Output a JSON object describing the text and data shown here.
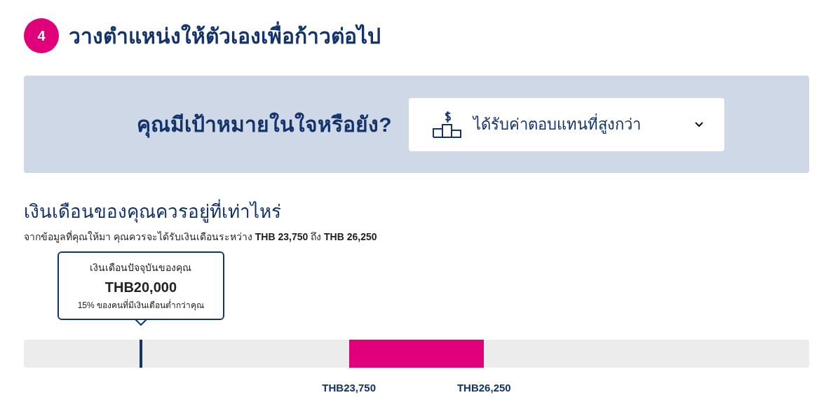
{
  "step": {
    "number": "4",
    "title": "วางตำแหน่งให้ตัวเองเพื่อก้าวต่อไป"
  },
  "goal": {
    "question": "คุณมีเป้าหมายในใจหรือยัง?",
    "value": "ได้รับค่าตอบแทนที่สูงกว่า"
  },
  "salary": {
    "title": "เงินเดือนของคุณควรอยู่ที่เท่าไหร่",
    "subtitle": "จากข้อมูลที่คุณให้มา คุณควรจะได้รับเงินเดือนระหว่าง **THB 23,750** ถึง **THB 26,250**",
    "current": {
      "label": "เงินเดือนปัจจุบันของคุณ",
      "amount": "THB20,000",
      "note": "15% ของคนที่มีเงินเดือนต่ำกว่าคุณ",
      "level": 0.149
    },
    "range_start": {
      "label": "THB23,750"
    },
    "range_end": {
      "label": "THB26,250"
    }
  }
}
